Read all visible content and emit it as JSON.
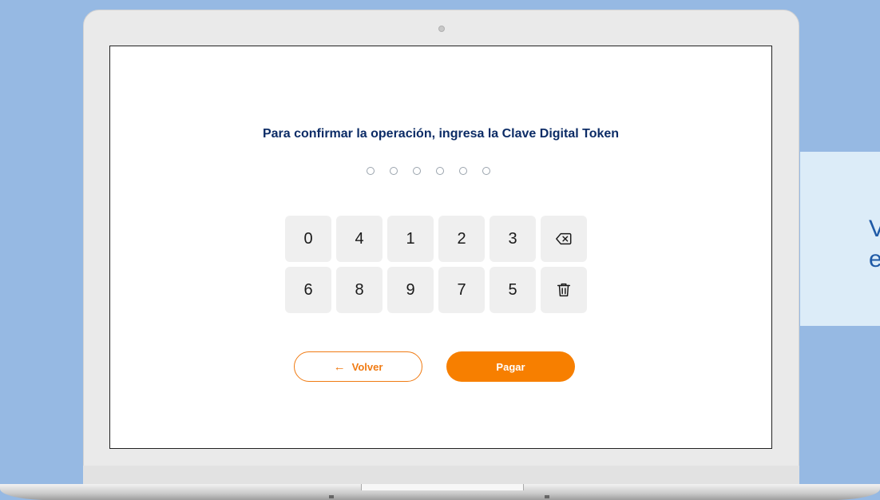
{
  "side_panel": {
    "text_line_1": "V",
    "text_line_2": "e"
  },
  "screen": {
    "title": "Para confirmar la operación, ingresa la Clave Digital Token",
    "pin": {
      "length": 6,
      "filled": 0
    },
    "keypad": {
      "row1": [
        "0",
        "4",
        "1",
        "2",
        "3"
      ],
      "row2": [
        "6",
        "8",
        "9",
        "7",
        "5"
      ],
      "backspace_icon": "backspace-icon",
      "clear_icon": "trash-icon"
    },
    "buttons": {
      "back_arrow": "←",
      "back_label": "Volver",
      "pay_label": "Pagar"
    },
    "colors": {
      "accent": "#f77f00",
      "title": "#0c2c66",
      "key_bg": "#efefef"
    }
  }
}
